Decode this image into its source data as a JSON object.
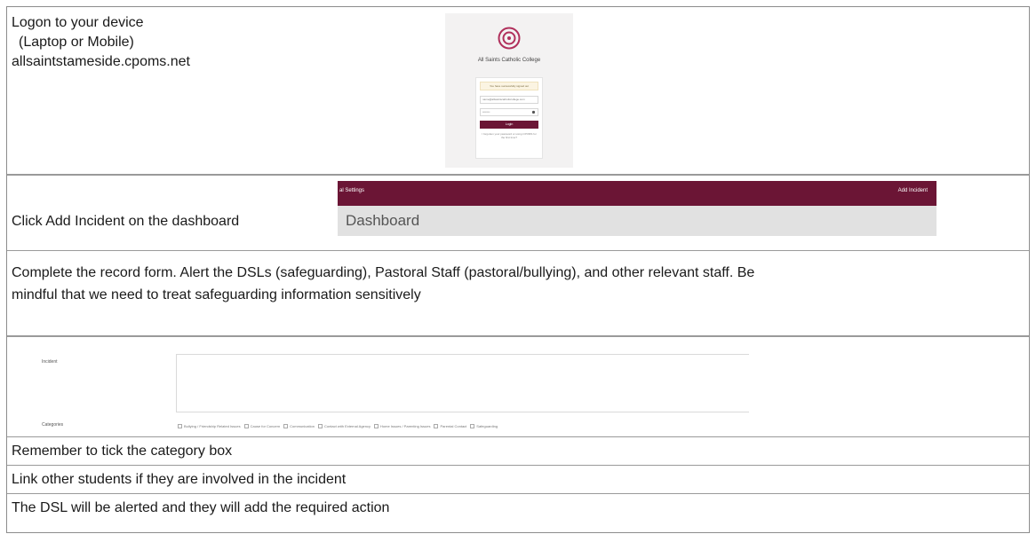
{
  "rows": {
    "logon": {
      "lines": [
        "Logon to your device",
        "(Laptop or Mobile)",
        "allsaintstameside.cpoms.net"
      ],
      "login_card": {
        "logo_icon": "target-rings-icon",
        "school_name": "All Saints Catholic College",
        "alert_text": "You have successfully signed out",
        "email_value": "name@allsaintscatholiccollege.com",
        "password_value": "••••••••",
        "login_button": "Login",
        "forgot_text": "I forgotten your password or using CPOMS for the first time?"
      }
    },
    "add_incident": {
      "instruction": "Click Add Incident on the dashboard",
      "bar_left": "al Settings",
      "bar_right": "Add Incident",
      "dashboard_title": "Dashboard"
    },
    "complete_form": {
      "line1": "Complete the record form. Alert the DSLs (safeguarding), Pastoral Staff (pastoral/bullying), and other relevant staff. Be",
      "line2": "mindful that we need to treat safeguarding information sensitively"
    },
    "incident_form": {
      "incident_label": "Incident",
      "categories_label": "Categories",
      "categories": [
        "Bullying / Friendship Related Issues",
        "Cause for Concern",
        "Communication",
        "Contact with External Agency",
        "Home Issues / Parenting Issues",
        "Parental Contact",
        "Safeguarding"
      ]
    },
    "tick_reminder": "Remember to tick the category box",
    "link_students": "Link other students if they are involved in the incident",
    "dsl_alert": "The DSL will be alerted and they will add the required action"
  },
  "colors": {
    "brand": "#6b1535",
    "border": "#9a9a9a",
    "dashboard_bg": "#e1e1e1"
  }
}
